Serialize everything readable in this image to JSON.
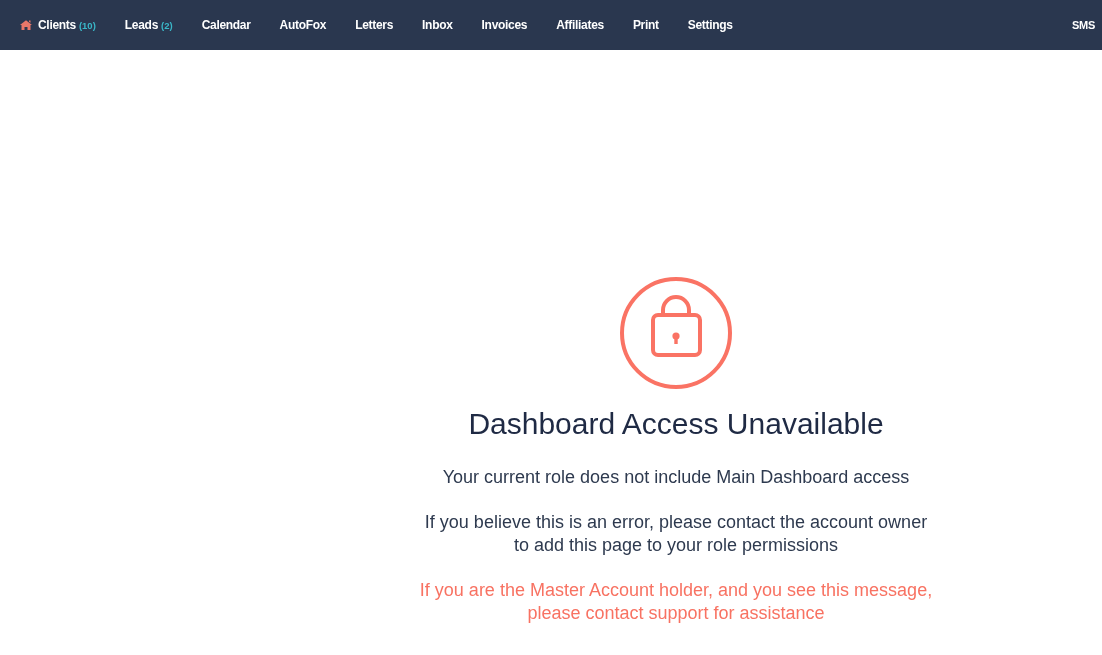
{
  "nav": {
    "home_link": {
      "label": "Clients",
      "count": "(10)"
    },
    "items": [
      {
        "label": "Leads",
        "count": "(2)"
      },
      {
        "label": "Calendar"
      },
      {
        "label": "AutoFox"
      },
      {
        "label": "Letters"
      },
      {
        "label": "Inbox"
      },
      {
        "label": "Invoices"
      },
      {
        "label": "Affiliates"
      },
      {
        "label": "Print"
      },
      {
        "label": "Settings"
      }
    ],
    "right_items": [
      {
        "label": "SMS"
      }
    ]
  },
  "notice": {
    "title": "Dashboard Access Unavailable",
    "message": "Your current role does not include Main Dashboard access",
    "instruction": "If you believe this is an error, please contact the account owner to add this page to your role permissions",
    "warning": "If you are the Master Account holder, and you see this message, please contact support for assistance"
  }
}
